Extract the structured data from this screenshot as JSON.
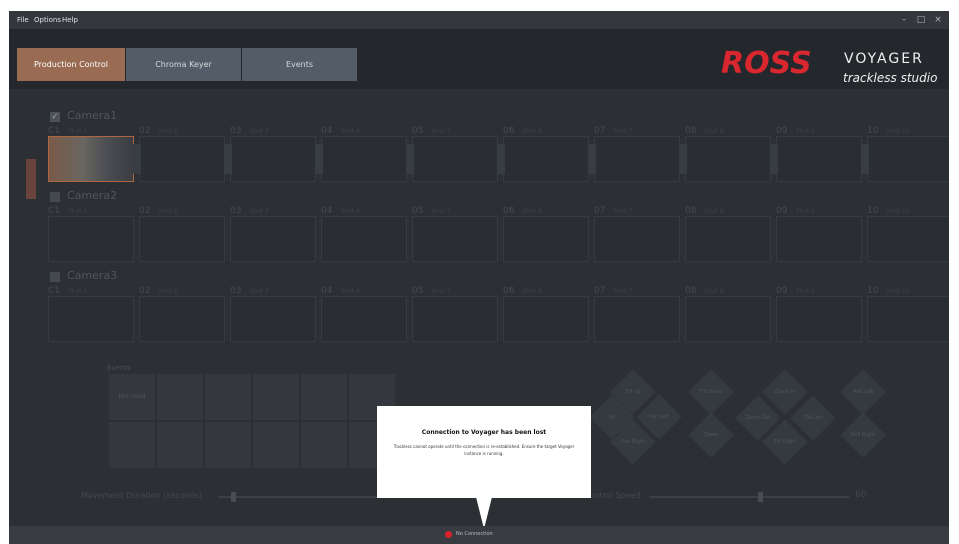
{
  "menu": {
    "file": "File",
    "options": "Options",
    "help": "Help"
  },
  "window_controls": {
    "minimize": "–",
    "maximize": "□",
    "close": "×"
  },
  "tabs": [
    {
      "label": "Production Control",
      "active": true
    },
    {
      "label": "Chroma Keyer",
      "active": false
    },
    {
      "label": "Events",
      "active": false
    }
  ],
  "branding": {
    "ross": "ROSS",
    "voyager": "VOYAGER",
    "subtitle": "trackless studio"
  },
  "cameras": [
    {
      "name": "Camera1",
      "checked": true
    },
    {
      "name": "Camera2",
      "checked": false
    },
    {
      "name": "Camera3",
      "checked": false
    }
  ],
  "shots": [
    {
      "id": "C1",
      "sub": "Shot 1"
    },
    {
      "id": "02",
      "sub": "Shot 2"
    },
    {
      "id": "03",
      "sub": "Shot 3"
    },
    {
      "id": "04",
      "sub": "Shot 4"
    },
    {
      "id": "05",
      "sub": "Shot 5"
    },
    {
      "id": "06",
      "sub": "Shot 6"
    },
    {
      "id": "07",
      "sub": "Shot 7"
    },
    {
      "id": "08",
      "sub": "Shot 8"
    },
    {
      "id": "09",
      "sub": "Shot 9"
    },
    {
      "id": "10",
      "sub": "Shot 10"
    }
  ],
  "events": {
    "label": "Events",
    "first_event": "Not used"
  },
  "joystick_labels": [
    "Tilt Up",
    "Up",
    "Pan Left",
    "Pan Right",
    "Tilt Down",
    "Down",
    "Zoom In",
    "Zoom Out",
    "Tilt Left",
    "Tilt Right",
    "Roll Left",
    "Roll Right"
  ],
  "sliders": {
    "duration_label": "Movement Duration (seconds)",
    "duration_value": "3",
    "speed_label": "Control Speed",
    "speed_value": "60"
  },
  "popup": {
    "title": "Connection to Voyager has been lost",
    "message": "Trackless cannot operate until the connection is re-established. Ensure the target Voyager instance is running."
  },
  "status": {
    "text": "No Connection",
    "color": "#d9232b"
  }
}
